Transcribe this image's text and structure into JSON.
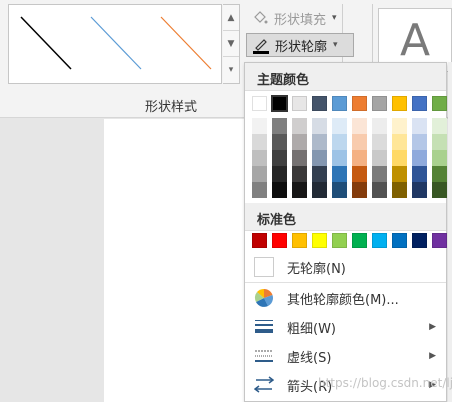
{
  "ribbon": {
    "group_label": "形状样式",
    "fill_label": "形状填充",
    "outline_label": "形状轮廓",
    "wordart_letter": "A",
    "gallery_lines": [
      {
        "name": "black-line",
        "color": "#000000"
      },
      {
        "name": "blue-line",
        "color": "#5b9bd5"
      },
      {
        "name": "orange-line",
        "color": "#ed7d31"
      }
    ]
  },
  "dropdown": {
    "theme_header": "主题颜色",
    "standard_header": "标准色",
    "theme_colors": [
      "#ffffff",
      "#000000",
      "#e7e6e6",
      "#44546a",
      "#5b9bd5",
      "#ed7d31",
      "#a5a5a5",
      "#ffc000",
      "#4472c4",
      "#70ad47"
    ],
    "theme_shades": [
      [
        "#f2f2f2",
        "#d9d9d9",
        "#bfbfbf",
        "#a6a6a6",
        "#808080"
      ],
      [
        "#7f7f7f",
        "#595959",
        "#404040",
        "#262626",
        "#0d0d0d"
      ],
      [
        "#d0cece",
        "#aeaaaa",
        "#757171",
        "#3a3838",
        "#171616"
      ],
      [
        "#d6dce5",
        "#adb9ca",
        "#8497b0",
        "#333f50",
        "#222a35"
      ],
      [
        "#deebf7",
        "#bdd7ee",
        "#9dc3e6",
        "#2e75b6",
        "#1f4e79"
      ],
      [
        "#fbe5d6",
        "#f8cbad",
        "#f4b183",
        "#c55a11",
        "#843c0c"
      ],
      [
        "#ededed",
        "#dbdbdb",
        "#c9c9c9",
        "#7b7b7b",
        "#525252"
      ],
      [
        "#fff2cc",
        "#ffe699",
        "#ffd966",
        "#bf9000",
        "#7f6000"
      ],
      [
        "#dae3f3",
        "#b4c7e7",
        "#8faadc",
        "#2f5597",
        "#203864"
      ],
      [
        "#e2f0d9",
        "#c5e0b4",
        "#a9d18e",
        "#548235",
        "#385723"
      ]
    ],
    "standard_colors": [
      "#c00000",
      "#ff0000",
      "#ffc000",
      "#ffff00",
      "#92d050",
      "#00b050",
      "#00b0f0",
      "#0070c0",
      "#002060",
      "#7030a0"
    ],
    "no_outline": "无轮廓(N)",
    "more_colors": "其他轮廓颜色(M)...",
    "weight": "粗细(W)",
    "dashes": "虚线(S)",
    "arrows": "箭头(R)"
  },
  "watermark": "https://blog.csdn.net/ljhq"
}
